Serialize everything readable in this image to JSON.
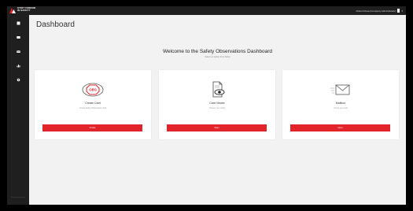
{
  "app": {
    "logo_text": "STOP CONDOR\nIN SAFETY",
    "user_label": "Robert Rosa (Company Administrator)",
    "brand_color": "#e3232a"
  },
  "sidebar": {
    "items": [
      {
        "icon": "square-icon"
      },
      {
        "icon": "card-icon"
      },
      {
        "icon": "envelope-icon"
      },
      {
        "icon": "chart-icon"
      },
      {
        "icon": "gear-icon"
      }
    ]
  },
  "page": {
    "title": "Dashboard",
    "welcome": "Welcome to the Safety Observations Dashboard",
    "subtitle": "Select an option from below"
  },
  "cards": [
    {
      "title": "Create Card",
      "description": "Create Safety Observation Card",
      "button": "Create",
      "icon": "stop-sign-icon",
      "icon_text": "OBS"
    },
    {
      "title": "Card Viewer",
      "description": "Review your cards",
      "button": "Open",
      "icon": "document-eye-icon"
    },
    {
      "title": "Mailbox",
      "description": "Check your mail",
      "button": "Open",
      "icon": "envelope-icon"
    }
  ]
}
